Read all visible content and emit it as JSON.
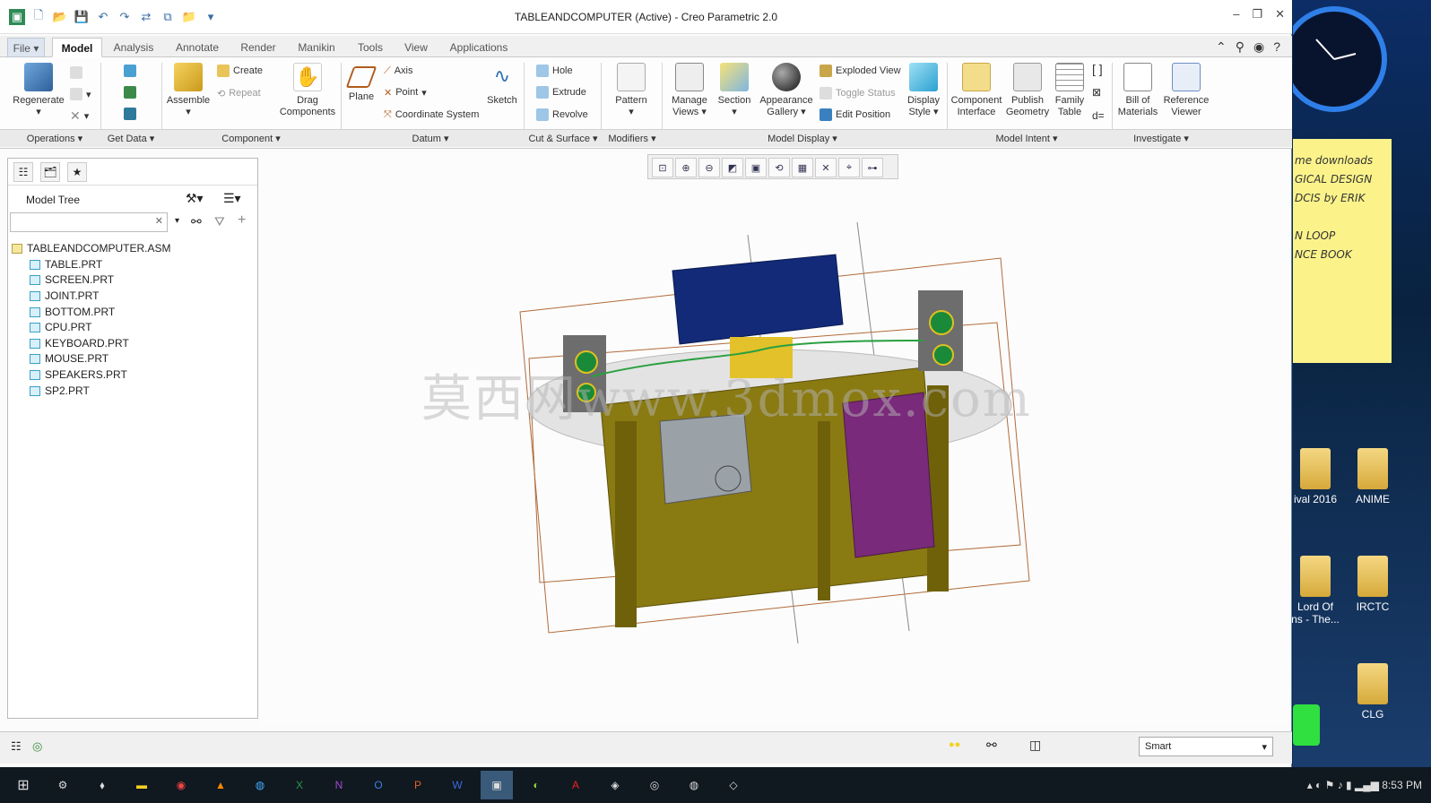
{
  "window": {
    "title": "TABLEANDCOMPUTER (Active) - Creo Parametric 2.0"
  },
  "tabs": [
    "File",
    "Model",
    "Analysis",
    "Annotate",
    "Render",
    "Manikin",
    "Tools",
    "View",
    "Applications"
  ],
  "ribbon": {
    "regenerate": "Regenerate",
    "assemble": "Assemble",
    "create": "Create",
    "repeat": "Repeat",
    "drag_components": "Drag\nComponents",
    "plane": "Plane",
    "axis": "Axis",
    "point": "Point",
    "coordinate_system": "Coordinate System",
    "sketch": "Sketch",
    "hole": "Hole",
    "extrude": "Extrude",
    "revolve": "Revolve",
    "pattern": "Pattern",
    "manage_views": "Manage\nViews",
    "section": "Section",
    "appearance_gallery": "Appearance\nGallery",
    "exploded_view": "Exploded View",
    "toggle_status": "Toggle Status",
    "edit_position": "Edit Position",
    "display_style": "Display\nStyle",
    "component_interface": "Component\nInterface",
    "publish_geometry": "Publish\nGeometry",
    "family_table": "Family\nTable",
    "bill_of_materials": "Bill of\nMaterials",
    "reference_viewer": "Reference\nViewer"
  },
  "groups": [
    "Operations",
    "Get Data",
    "Component",
    "Datum",
    "Cut & Surface",
    "Modifiers",
    "Model Display",
    "Model Intent",
    "Investigate"
  ],
  "model_tree": {
    "title": "Model Tree",
    "search_value": "",
    "items": [
      {
        "name": "TABLEANDCOMPUTER.ASM",
        "type": "asm"
      },
      {
        "name": "TABLE.PRT",
        "type": "prt"
      },
      {
        "name": "SCREEN.PRT",
        "type": "prt"
      },
      {
        "name": "JOINT.PRT",
        "type": "prt"
      },
      {
        "name": "BOTTOM.PRT",
        "type": "prt"
      },
      {
        "name": "CPU.PRT",
        "type": "prt"
      },
      {
        "name": "KEYBOARD.PRT",
        "type": "prt"
      },
      {
        "name": "MOUSE.PRT",
        "type": "prt"
      },
      {
        "name": "SPEAKERS.PRT",
        "type": "prt"
      },
      {
        "name": "SP2.PRT",
        "type": "prt"
      }
    ]
  },
  "viewport": {
    "watermark": "莫西网www.3dmox.com"
  },
  "statusbar": {
    "selection_filter": "Smart"
  },
  "desktop": {
    "sticky_lines": [
      "me downloads",
      "GICAL DESIGN",
      "DCIS by ERIK",
      "",
      "N LOOP",
      "NCE BOOK"
    ],
    "icons": [
      {
        "label": "ival 2016"
      },
      {
        "label": "ANIME"
      },
      {
        "label": "Lord Of\nns - The..."
      },
      {
        "label": "IRCTC"
      },
      {
        "label": "CLG"
      }
    ]
  },
  "taskbar": {
    "clock": "8:53 PM"
  },
  "colors": {
    "accent": "#3a6ea5",
    "table": "#8a7a12",
    "screen": "#122a78",
    "cpu_case": "#7a2a7a"
  }
}
